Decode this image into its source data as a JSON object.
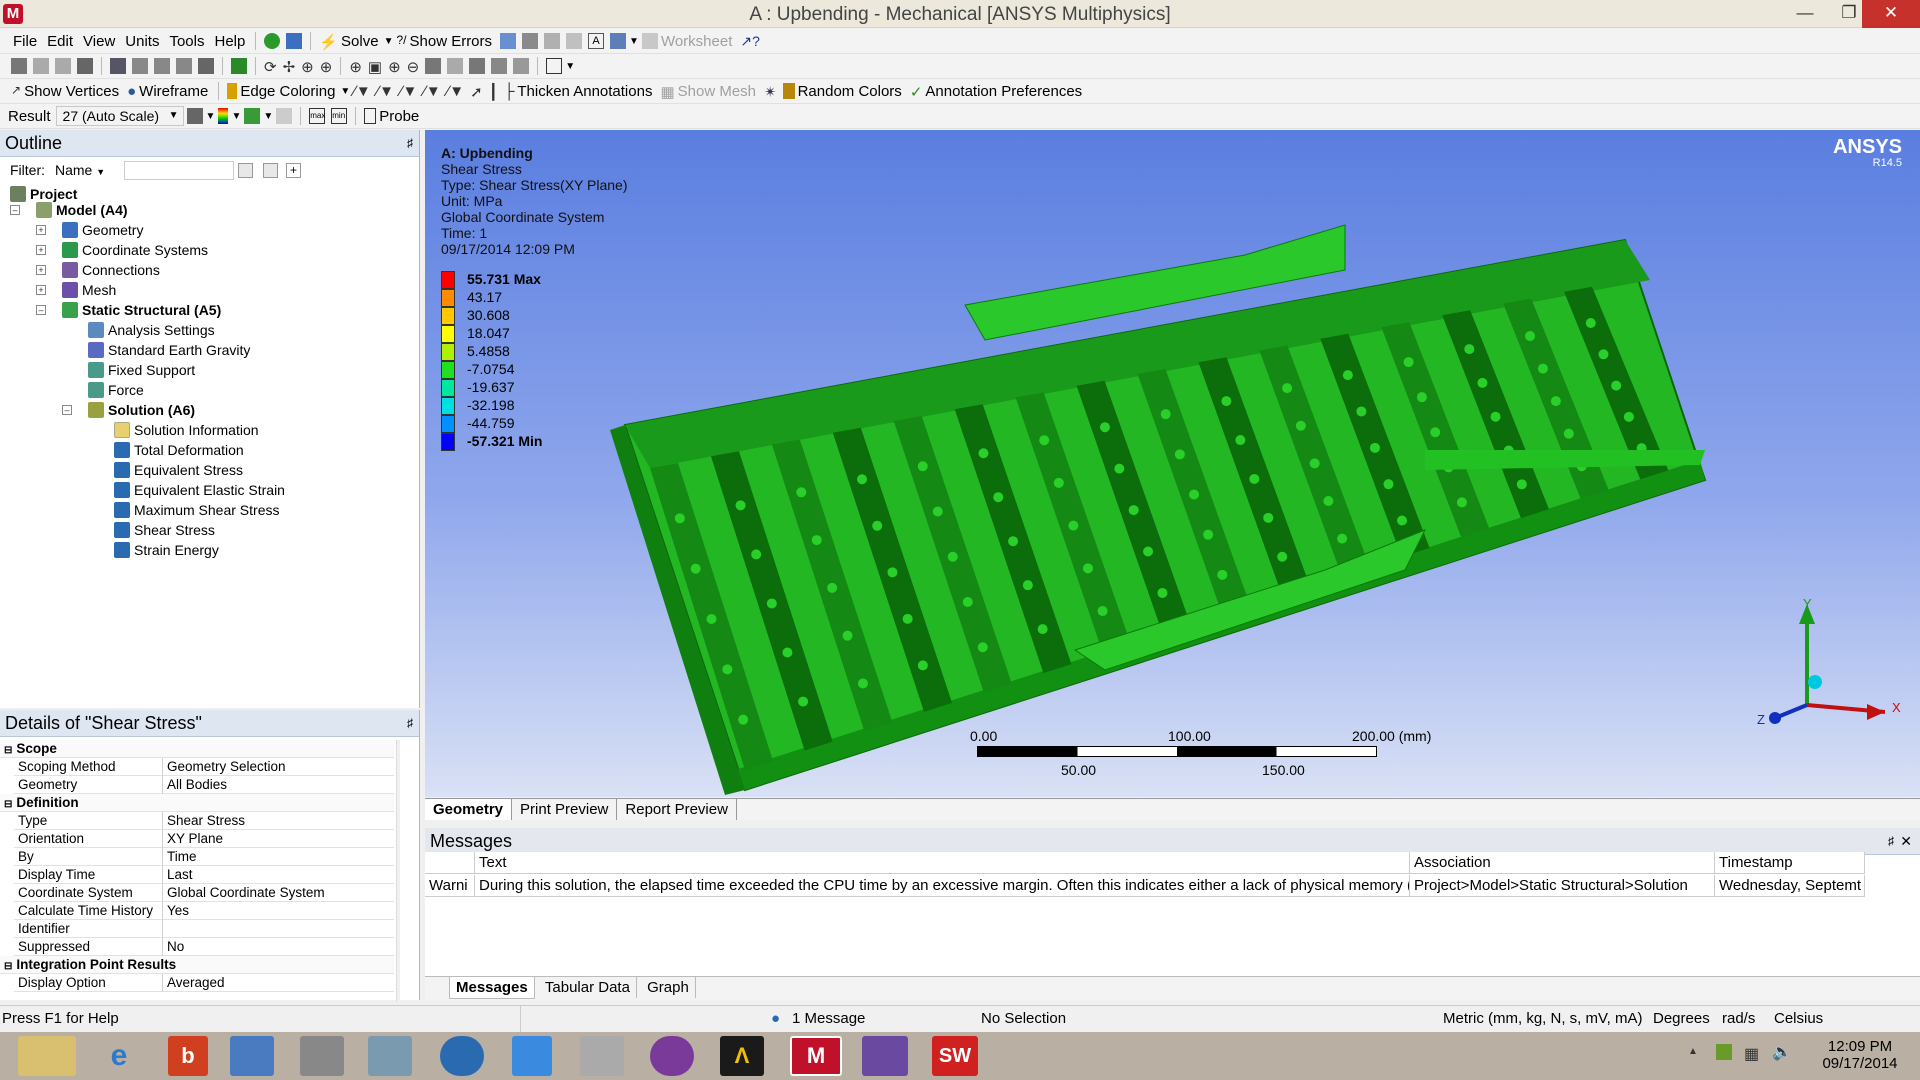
{
  "window": {
    "title": "A : Upbending - Mechanical [ANSYS Multiphysics]"
  },
  "menu": {
    "items": [
      "File",
      "Edit",
      "View",
      "Units",
      "Tools",
      "Help"
    ]
  },
  "toolbar1": {
    "solve": "Solve",
    "show_errors": "Show Errors",
    "worksheet": "Worksheet"
  },
  "toolbar3": {
    "show_vertices": "Show Vertices",
    "wireframe": "Wireframe",
    "edge_coloring": "Edge Coloring",
    "thicken_annotations": "Thicken Annotations",
    "show_mesh": "Show Mesh",
    "random_colors": "Random Colors",
    "annotation_preferences": "Annotation Preferences"
  },
  "toolbar4": {
    "result_label": "Result",
    "result_value": "27 (Auto Scale)",
    "probe": "Probe"
  },
  "outline": {
    "title": "Outline",
    "filter_label": "Filter:",
    "filter_value": "Name",
    "tree": {
      "project": "Project",
      "model": "Model (A4)",
      "geometry": "Geometry",
      "coordinate_systems": "Coordinate Systems",
      "connections": "Connections",
      "mesh": "Mesh",
      "static": "Static Structural (A5)",
      "analysis_settings": "Analysis Settings",
      "gravity": "Standard Earth Gravity",
      "fixed_support": "Fixed Support",
      "force": "Force",
      "solution": "Solution (A6)",
      "solution_information": "Solution Information",
      "total_deformation": "Total Deformation",
      "equivalent_stress": "Equivalent Stress",
      "equivalent_elastic_strain": "Equivalent Elastic Strain",
      "maximum_shear_stress": "Maximum Shear Stress",
      "shear_stress": "Shear Stress",
      "strain_energy": "Strain Energy"
    }
  },
  "details": {
    "title": "Details of \"Shear Stress\"",
    "sections": {
      "scope": "Scope",
      "definition": "Definition",
      "integration": "Integration Point Results"
    },
    "rows": {
      "scoping_method": {
        "k": "Scoping Method",
        "v": "Geometry Selection"
      },
      "geometry": {
        "k": "Geometry",
        "v": "All Bodies"
      },
      "type": {
        "k": "Type",
        "v": "Shear Stress"
      },
      "orientation": {
        "k": "Orientation",
        "v": "XY Plane"
      },
      "by": {
        "k": "By",
        "v": "Time"
      },
      "display_time": {
        "k": "Display Time",
        "v": "Last"
      },
      "coordinate_system": {
        "k": "Coordinate System",
        "v": "Global Coordinate System"
      },
      "calc_time_history": {
        "k": "Calculate Time History",
        "v": "Yes"
      },
      "identifier": {
        "k": "Identifier",
        "v": ""
      },
      "suppressed": {
        "k": "Suppressed",
        "v": "No"
      },
      "display_option": {
        "k": "Display Option",
        "v": "Averaged"
      }
    }
  },
  "viewport": {
    "info": {
      "title": "A: Upbending",
      "result": "Shear Stress",
      "type": "Type: Shear Stress(XY Plane)",
      "unit": "Unit: MPa",
      "cs": "Global Coordinate System",
      "time": "Time: 1",
      "date": "09/17/2014 12:09 PM"
    },
    "brand": "ANSYS",
    "brand_version": "R14.5",
    "legend": [
      {
        "label": "55.731 Max",
        "color": "#ff0000"
      },
      {
        "label": "43.17",
        "color": "#ff8c00"
      },
      {
        "label": "30.608",
        "color": "#ffc800"
      },
      {
        "label": "18.047",
        "color": "#ffff00"
      },
      {
        "label": "5.4858",
        "color": "#b0f000"
      },
      {
        "label": "-7.0754",
        "color": "#20e020"
      },
      {
        "label": "-19.637",
        "color": "#00e8a0"
      },
      {
        "label": "-32.198",
        "color": "#00e0e0"
      },
      {
        "label": "-44.759",
        "color": "#0090ff"
      },
      {
        "label": "-57.321 Min",
        "color": "#0000ff"
      }
    ],
    "scale": {
      "t0": "0.00",
      "t100": "100.00",
      "t200": "200.00 (mm)",
      "t50": "50.00",
      "t150": "150.00"
    },
    "triad": {
      "x": "X",
      "y": "Y",
      "z": "Z"
    },
    "colors": {
      "model": "#22c822",
      "model_dark": "#0b6e0b"
    }
  },
  "view_tabs": [
    "Geometry",
    "Print Preview",
    "Report Preview"
  ],
  "messages": {
    "title": "Messages",
    "columns": [
      "Text",
      "Association",
      "Timestamp"
    ],
    "rows": [
      {
        "type": "Warni",
        "text": "During this solution, the elapsed time exceeded the CPU time by an excessive margin.  Often this indicates either a lack of physical memory (",
        "association": "Project>Model>Static Structural>Solution",
        "timestamp": "Wednesday, Septemt"
      }
    ],
    "tabs": [
      "Messages",
      "Tabular Data",
      "Graph"
    ]
  },
  "status": {
    "help": "Press F1 for Help",
    "messages": "1 Message",
    "selection": "No Selection",
    "units": "Metric (mm, kg, N, s, mV, mA)",
    "angle": "Degrees",
    "rate": "rad/s",
    "temp": "Celsius"
  },
  "taskbar": {
    "time": "12:09 PM",
    "date": "09/17/2014"
  }
}
